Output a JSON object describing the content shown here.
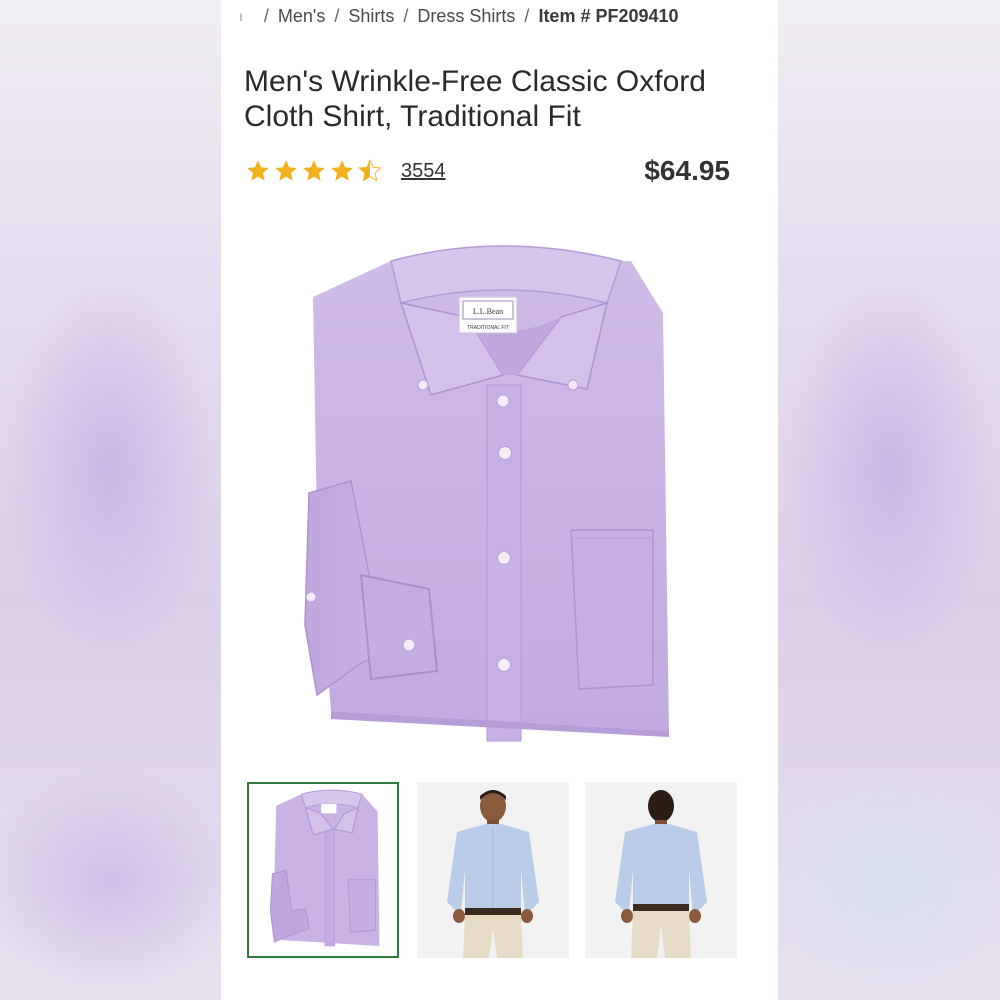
{
  "breadcrumb": {
    "cut": "ı",
    "items": [
      "Men's",
      "Shirts",
      "Dress Shirts"
    ],
    "current": "Item # PF209410",
    "separator": "/"
  },
  "product": {
    "title": "Men's Wrinkle-Free Classic Oxford Cloth Shirt, Traditional Fit",
    "rating": 4.5,
    "rating_max": 5,
    "review_count": "3554",
    "price": "$64.95"
  },
  "label": {
    "brand": "L.L.Bean",
    "fit": "TRADITIONAL FIT"
  },
  "thumbnails": [
    {
      "name": "folded-lilac-shirt",
      "selected": true
    },
    {
      "name": "model-front-blue-shirt",
      "selected": false
    },
    {
      "name": "model-back-blue-shirt",
      "selected": false
    }
  ],
  "colors": {
    "star": "#f2b01e",
    "shirt": "#c8b2e2",
    "shirt_dark": "#a98fcd",
    "selected_border": "#2e7d3c",
    "model_shirt": "#b9cde8"
  }
}
